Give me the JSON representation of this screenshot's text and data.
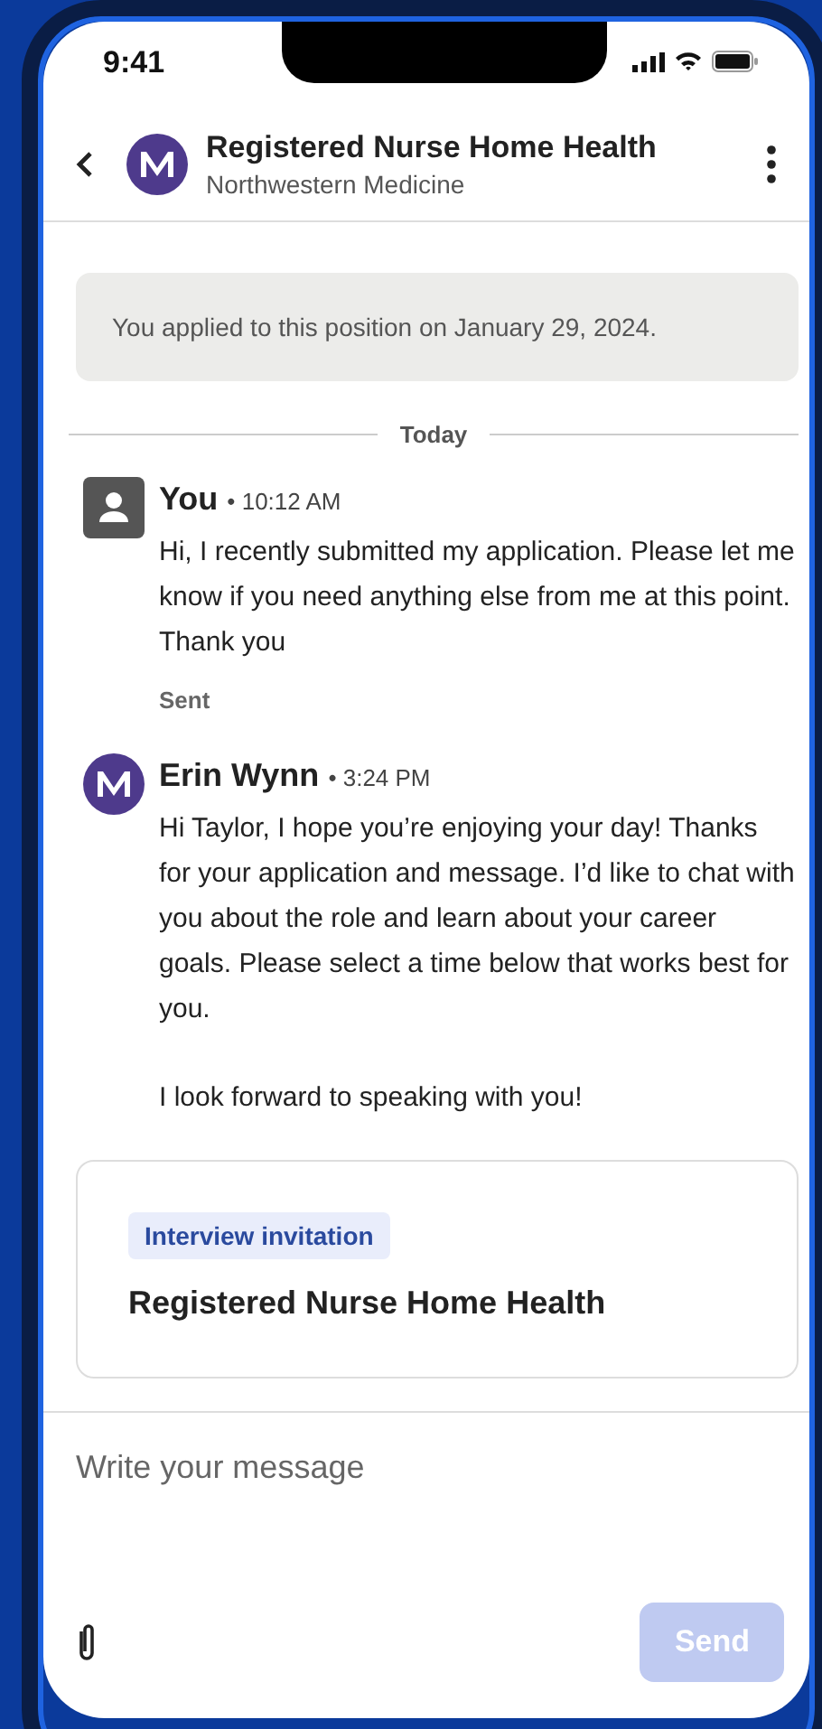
{
  "status_bar": {
    "time": "9:41"
  },
  "header": {
    "title": "Registered Nurse Home Health",
    "subtitle": "Northwestern Medicine"
  },
  "notice": "You applied to this position on January 29, 2024.",
  "date_divider": "Today",
  "messages": [
    {
      "kind": "user",
      "sender": "You",
      "time": "• 10:12 AM",
      "paragraphs": [
        "Hi, I recently submitted my application. Please let me know if you need anything else from me at this point. Thank you"
      ],
      "status": "Sent"
    },
    {
      "kind": "logo",
      "sender": "Erin Wynn",
      "time": "• 3:24 PM",
      "paragraphs": [
        "Hi Taylor, I hope you’re enjoying your day! Thanks for your application and message. I’d like to chat with you about the role and learn about your career goals. Please select a time below that works best for you.",
        "I look forward to speaking with you!"
      ]
    }
  ],
  "invitation_card": {
    "tag": "Interview invitation",
    "title": "Registered Nurse Home Health"
  },
  "composer": {
    "placeholder": "Write your message",
    "send_button": {
      "label": "Send",
      "disabled": true
    }
  }
}
